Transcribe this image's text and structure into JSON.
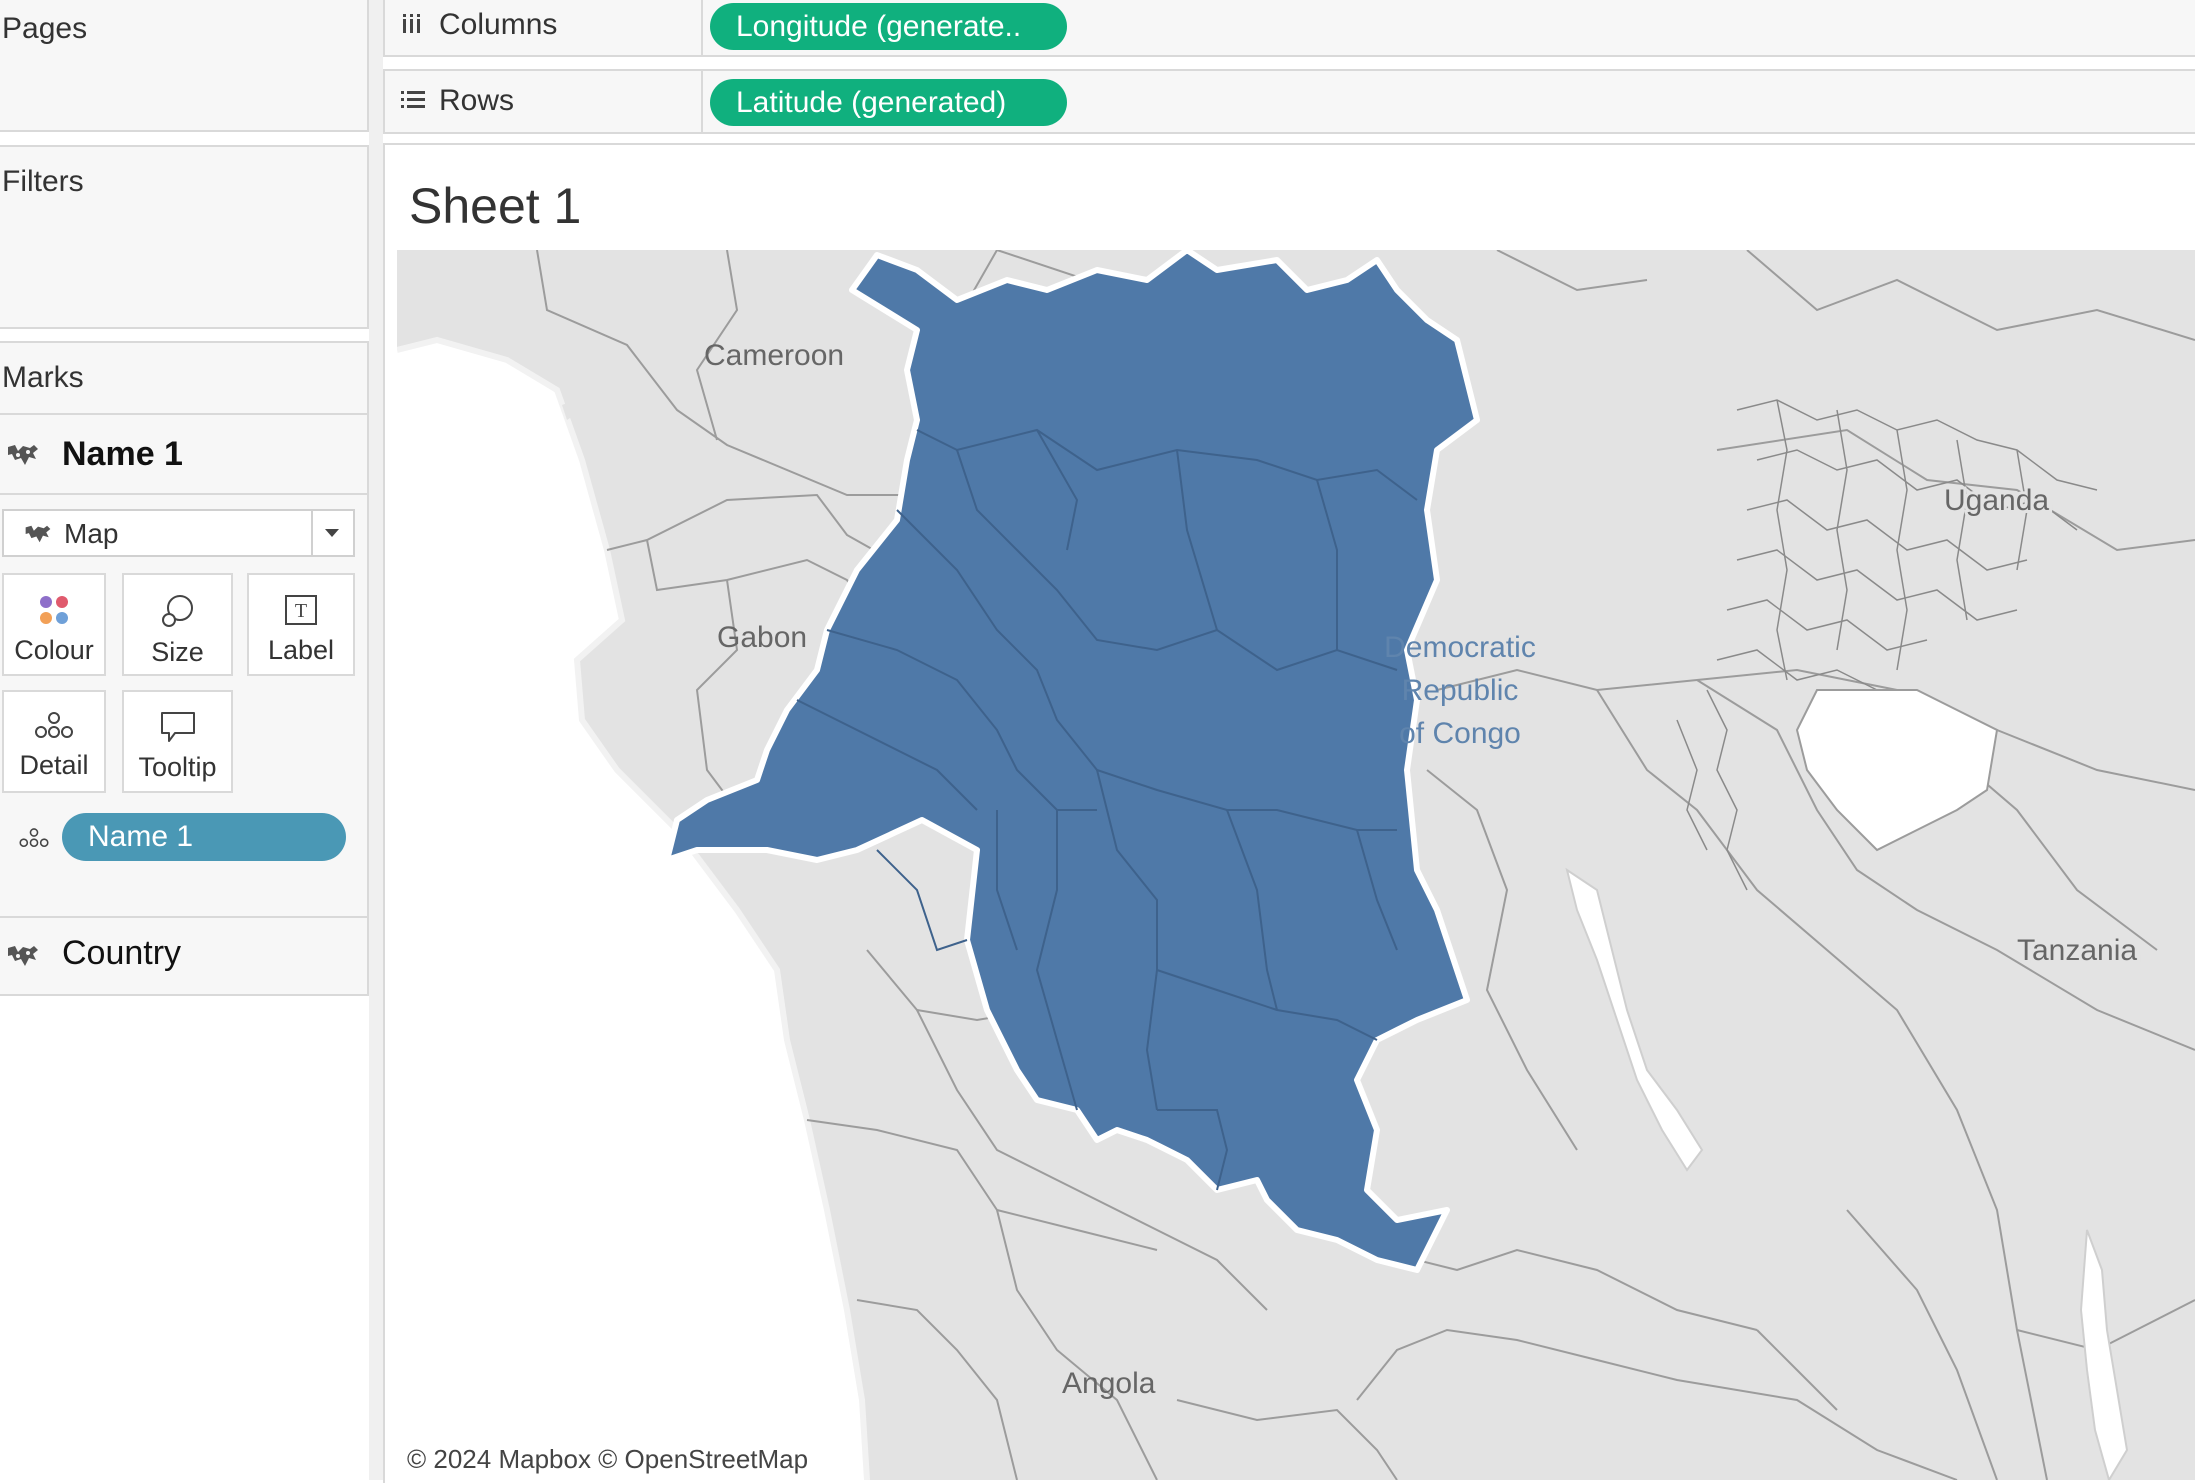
{
  "shelves": {
    "pages_label": "Pages",
    "filters_label": "Filters",
    "columns_label": "Columns",
    "columns_pill": "Longitude (generate..",
    "rows_label": "Rows",
    "rows_pill": "Latitude (generated)"
  },
  "marks": {
    "title": "Marks",
    "layer_name": "Name 1",
    "mark_type": "Map",
    "cards": {
      "colour": "Colour",
      "size": "Size",
      "label": "Label",
      "detail": "Detail",
      "tooltip": "Tooltip"
    },
    "detail_pill": "Name 1",
    "layer2_name": "Country"
  },
  "sheet": {
    "title": "Sheet 1"
  },
  "map": {
    "country_labels": [
      "Cameroon",
      "Gabon",
      "Uganda",
      "Tanzania",
      "Angola",
      "Democratic",
      "Republic",
      "of Congo"
    ],
    "attribution": "© 2024 Mapbox © OpenStreetMap",
    "highlight_color": "#4f79a8",
    "land_color": "#e3e3e3",
    "ocean_color": "#ffffff"
  },
  "colors": {
    "pill_green": "#10b07e",
    "pill_blue": "#4a98b5"
  }
}
